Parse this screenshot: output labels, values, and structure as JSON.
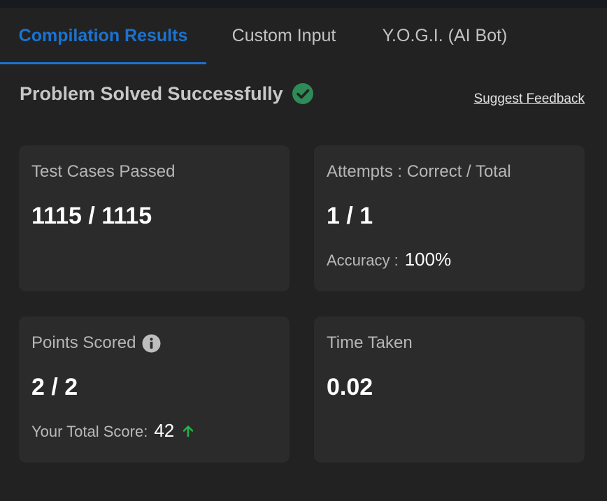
{
  "tabs": [
    {
      "label": "Compilation Results",
      "active": true
    },
    {
      "label": "Custom Input",
      "active": false
    },
    {
      "label": "Y.O.G.I. (AI Bot)",
      "active": false
    }
  ],
  "status": {
    "title": "Problem Solved Successfully",
    "icon": "check-circle-icon",
    "feedback_link": "Suggest Feedback"
  },
  "cards": {
    "test_cases": {
      "label": "Test Cases Passed",
      "value": "1115 / 1115"
    },
    "attempts": {
      "label": "Attempts : Correct / Total",
      "value": "1 / 1",
      "accuracy_label": "Accuracy :",
      "accuracy_value": "100%"
    },
    "points": {
      "label": "Points Scored",
      "value": "2 / 2",
      "total_label": "Your Total Score:",
      "total_value": "42",
      "info_icon": "info-icon",
      "trend_icon": "arrow-up-icon"
    },
    "time": {
      "label": "Time Taken",
      "value": "0.02"
    }
  },
  "colors": {
    "accent": "#1a73d1",
    "success": "#2e8b57",
    "trend_up": "#22b24c",
    "background": "#222222",
    "card": "#2b2b2b"
  }
}
